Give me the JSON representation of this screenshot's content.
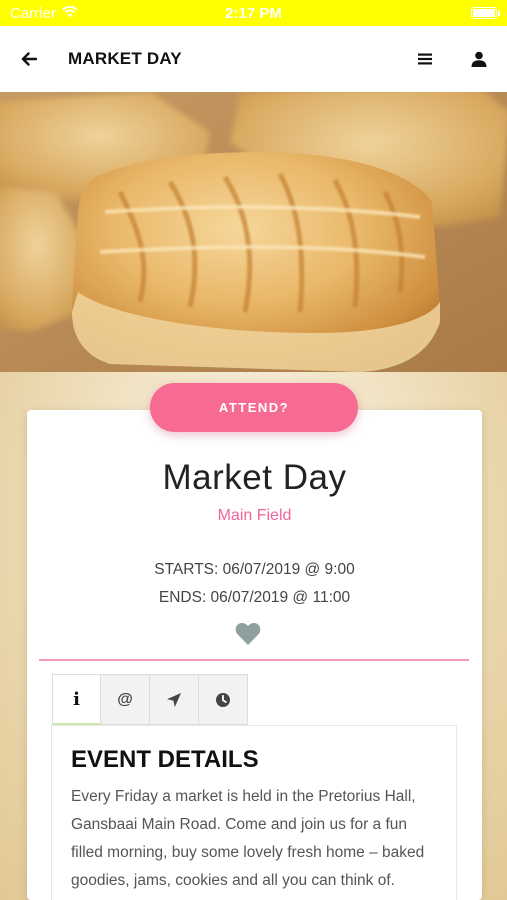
{
  "status_bar": {
    "carrier": "Carrier",
    "time": "2:17 PM"
  },
  "nav": {
    "title": "MARKET DAY",
    "back_icon": "arrow-left-icon",
    "menu_icon": "menu-icon",
    "profile_icon": "user-icon"
  },
  "hero": {
    "image": "pastry-photo"
  },
  "attend_button": {
    "label": "ATTEND?"
  },
  "event": {
    "title": "Market Day",
    "location": "Main Field",
    "starts": "STARTS: 06/07/2019 @ 9:00",
    "ends": "ENDS: 06/07/2019 @ 11:00",
    "favorite_icon": "heart-icon"
  },
  "tabs": [
    {
      "name": "info",
      "icon": "info-icon",
      "glyph": "i",
      "active": true
    },
    {
      "name": "contact",
      "icon": "at-icon",
      "glyph": "@",
      "active": false
    },
    {
      "name": "location",
      "icon": "location-arrow-icon",
      "active": false
    },
    {
      "name": "time",
      "icon": "clock-icon",
      "active": false
    }
  ],
  "details": {
    "heading": "EVENT DETAILS",
    "body": "Every Friday a market is held in the Pretorius Hall, Gansbaai Main Road. Come and join us for a fun filled morning, buy some lovely fresh home – baked goodies, jams, cookies and all you can think of."
  },
  "colors": {
    "status_bar": "#ffff00",
    "accent_pink": "#f76b93",
    "location_pink": "#f0649a",
    "divider_pink": "#f49abb",
    "heart_gray": "#8fa0a0"
  }
}
